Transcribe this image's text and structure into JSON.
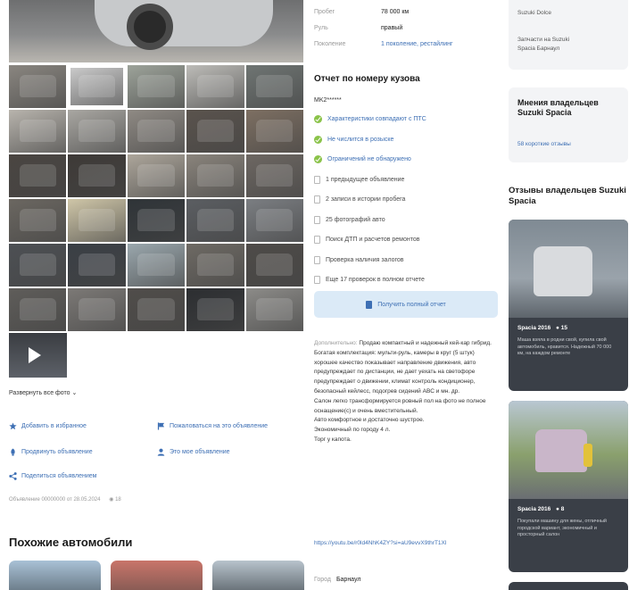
{
  "gallery": {
    "thumb_colors": [
      "#8a8680",
      "#cfcfcf",
      "#9da39a",
      "#bdbcb8",
      "#6f7573",
      "#b8b4ad",
      "#a9a7a2",
      "#8f8a84",
      "#5a534d",
      "#7d6f62",
      "#4a4541",
      "#3e3a37",
      "#ada69b",
      "#8a847c",
      "#6d6762",
      "#6b6761",
      "#cfc6a8",
      "#2f3438",
      "#5b5e62",
      "#7b7e82",
      "#4d5054",
      "#3a3f45",
      "#9aa7ad",
      "#6e6a64",
      "#4e4b48",
      "#5f5d5a",
      "#7c7976",
      "#504d4a",
      "#2c2e31",
      "#8c8b88"
    ],
    "selected_index": 1
  },
  "left": {
    "show_all_link": "Развернуть все фото ⌄",
    "actions": {
      "favorite": "Добавить в избранное",
      "complain": "Пожаловаться на это объявление",
      "promote": "Продвинуть объявление",
      "my_ads": "Это мое объявление",
      "share": "Поделиться объявлением"
    },
    "meta": "Объявление 00000000 от 28.05.2024",
    "views": "18",
    "similar_title": "Похожие автомобили"
  },
  "specs": [
    {
      "key": "Пробег",
      "value": "78 000 км",
      "link": false
    },
    {
      "key": "Руль",
      "value": "правый",
      "link": false
    },
    {
      "key": "Поколение",
      "value": "1 поколение, рестайлинг",
      "link": true
    }
  ],
  "report": {
    "title": "Отчет по номеру кузова",
    "vin": "MK2******",
    "checks": [
      {
        "text": "Характеристики совпадают с ПТС",
        "ok": true
      },
      {
        "text": "Не числится в розыске",
        "ok": true
      },
      {
        "text": "Ограничений не обнаружено",
        "ok": true
      },
      {
        "text": "1 предыдущее объявление",
        "ok": false
      },
      {
        "text": "2 записи в истории пробега",
        "ok": false
      },
      {
        "text": "25 фотографий авто",
        "ok": false
      },
      {
        "text": "Поиск ДТП и расчетов ремонтов",
        "ok": false
      },
      {
        "text": "Проверка наличия залогов",
        "ok": false
      },
      {
        "text": "Еще 17 проверок в полном отчете",
        "ok": false
      }
    ],
    "button": "Получить полный отчет"
  },
  "description": {
    "label": "Дополнительно:",
    "lines": [
      "Продаю компактный и надежный кей-кар гибрид.",
      "Богатая комплектация: мульти-руль, камеры в круг (5 штук) хорошее качество показывает направление движения, авто предупреждает по дистанции, не дает уехать на светофоре предупреждает о движении, климат контроль кондиционер, безопасный кейлесс, подогрев сидений ABC и мн. др.",
      "Салон легко трансформируется ровный пол на фото не полное оснащение(с) и очень вместительный.",
      "Авто комфортное и достаточно шустрое.",
      "Экономичный по городу 4 л.",
      "Торг у капота."
    ],
    "link": "https://youtu.be/r0ld4NhK4ZY?si=aU9evvX9thrT1Xl",
    "city_key": "Город",
    "city_value": "Барнаул"
  },
  "right": {
    "top_card_lines": [
      "Запчасти на Suzuki",
      "Spacia Барнаул"
    ],
    "top_card_line1": "Suzuki Dolce",
    "opinion_title": "Мнения владельцев Suzuki Spacia",
    "opinion_link": "58 короткие отзывы",
    "reviews_title": "Отзывы владельцев Suzuki Spacia",
    "reviews": [
      {
        "title": "Spacia 2016",
        "count": "15",
        "text": "Маша взяла в родни свой, купила свой автомобиль, нравится. Надежный 70 000 км, на каждом ремонте",
        "photo": "#9aa3ab"
      },
      {
        "title": "Spacia 2016",
        "count": "8",
        "text": "Покупали машину для жены, отличный городской вариант, экономичный и просторный салон",
        "photo": "#8aa06d"
      }
    ]
  }
}
